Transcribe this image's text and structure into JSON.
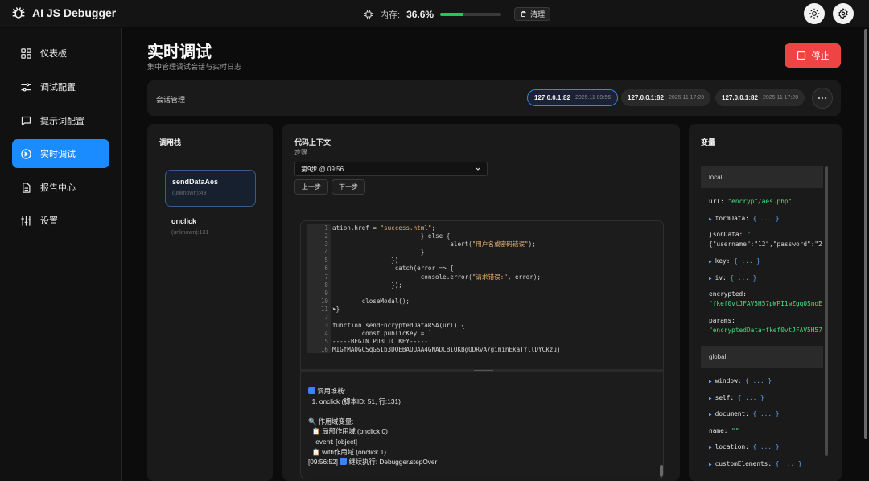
{
  "app": {
    "name": "AI JS Debugger"
  },
  "memory": {
    "label": "内存:",
    "value": "36.6%",
    "percent": 36.6,
    "clear_label": "清理"
  },
  "colors": {
    "accent": "#1a8cff",
    "stop": "#ef4444",
    "memory_bar": "#22c55e"
  },
  "sidebar": {
    "items": [
      {
        "label": "仪表板",
        "icon": "dashboard-icon"
      },
      {
        "label": "调试配置",
        "icon": "sliders-icon"
      },
      {
        "label": "提示词配置",
        "icon": "chat-icon"
      },
      {
        "label": "实时调试",
        "icon": "play-circle-icon",
        "active": true
      },
      {
        "label": "报告中心",
        "icon": "document-icon"
      },
      {
        "label": "设置",
        "icon": "settings-sliders-icon"
      }
    ]
  },
  "page": {
    "title": "实时调试",
    "subtitle": "集中管理调试会话与实时日志",
    "stop_label": "停止"
  },
  "sessions": {
    "label": "会话管理",
    "items": [
      {
        "ip": "127.0.0.1:82",
        "time": "2025.11 09:56",
        "selected": true
      },
      {
        "ip": "127.0.0.1:82",
        "time": "2025.11 17:20"
      },
      {
        "ip": "127.0.0.1:82",
        "time": "2025.11 17:20"
      }
    ]
  },
  "callstack": {
    "title": "调用栈",
    "items": [
      {
        "fn": "sendDataAes",
        "loc": "(unknown):49",
        "selected": true
      },
      {
        "fn": "onclick",
        "loc": "(unknown):131"
      }
    ]
  },
  "context": {
    "title": "代码上下文",
    "step_label": "步骤",
    "step_value": "第9步 @ 09:56",
    "prev_label": "上一步",
    "next_label": "下一步",
    "code": {
      "line_numbers": [
        "1",
        "2",
        "3",
        "4",
        "5",
        "6",
        "7",
        "8",
        "9",
        "10",
        "11",
        "12",
        "13",
        "14",
        "15",
        "16"
      ],
      "lines": [
        "ation.href = \"success.html\";",
        "                        } else {",
        "                                alert(\"用户名或密码错误\");",
        "                        }",
        "                })",
        "                .catch(error => {",
        "                        console.error(\"请求错误:\", error);",
        "                });",
        "",
        "        closeModal();",
        "➤}",
        "",
        "function sendEncryptedDataRSA(url) {",
        "        const publicKey = `",
        "-----BEGIN PUBLIC KEY-----",
        "MIGfMA0GCSqGSIb3DQEBAQUAA4GNADCBiQKBgQDRvA7giminEkaTYllDYCkzuj"
      ]
    },
    "console": {
      "stack_title": "调用堆栈:",
      "stack_line": "1. onclick (脚本ID: 51, 行:131)",
      "scope_title": "🔍 作用域变量:",
      "local_scope": "📋 局部作用域 (onclick 0)",
      "event_line": "event: [object]",
      "with_scope": "📋 with作用域 (onclick 1)",
      "log_time": "[09:56:52]",
      "log_text": "继续执行: Debugger.stepOver"
    }
  },
  "variables": {
    "title": "变量",
    "local_label": "local",
    "global_label": "global",
    "local": [
      {
        "name": "url:",
        "value": "\"encrypt/aes.php\"",
        "kind": "string"
      },
      {
        "name": "formData:",
        "value": "{ ... }",
        "kind": "object"
      },
      {
        "name": "jsonData:",
        "value": "\"",
        "value2": "{\"username\":\"12\",\"password\":\"2",
        "kind": "string2"
      },
      {
        "name": "key:",
        "value": "{ ... }",
        "kind": "object"
      },
      {
        "name": "iv:",
        "value": "{ ... }",
        "kind": "object"
      },
      {
        "name": "encrypted:",
        "value2": "\"fkef0vtJFAV5H57pWPI1wZgq0SnoE",
        "kind": "string2"
      },
      {
        "name": "params:",
        "value2": "\"encryptedData=fkef0vtJFAV5H57",
        "kind": "string2"
      }
    ],
    "global": [
      {
        "name": "window:",
        "value": "{ ... }",
        "kind": "object"
      },
      {
        "name": "self:",
        "value": "{ ... }",
        "kind": "object"
      },
      {
        "name": "document:",
        "value": "{ ... }",
        "kind": "object"
      },
      {
        "name": "name:",
        "value": "\"\"",
        "kind": "string"
      },
      {
        "name": "location:",
        "value": "{ ... }",
        "kind": "object"
      },
      {
        "name": "customElements:",
        "value": "{ ... }",
        "kind": "object"
      }
    ]
  }
}
